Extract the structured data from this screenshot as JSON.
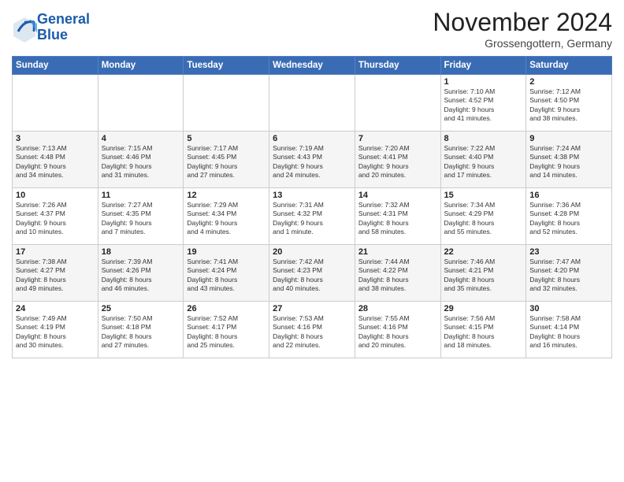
{
  "logo": {
    "line1": "General",
    "line2": "Blue"
  },
  "title": "November 2024",
  "location": "Grossengottern, Germany",
  "days_of_week": [
    "Sunday",
    "Monday",
    "Tuesday",
    "Wednesday",
    "Thursday",
    "Friday",
    "Saturday"
  ],
  "weeks": [
    [
      {
        "day": "",
        "info": ""
      },
      {
        "day": "",
        "info": ""
      },
      {
        "day": "",
        "info": ""
      },
      {
        "day": "",
        "info": ""
      },
      {
        "day": "",
        "info": ""
      },
      {
        "day": "1",
        "info": "Sunrise: 7:10 AM\nSunset: 4:52 PM\nDaylight: 9 hours\nand 41 minutes."
      },
      {
        "day": "2",
        "info": "Sunrise: 7:12 AM\nSunset: 4:50 PM\nDaylight: 9 hours\nand 38 minutes."
      }
    ],
    [
      {
        "day": "3",
        "info": "Sunrise: 7:13 AM\nSunset: 4:48 PM\nDaylight: 9 hours\nand 34 minutes."
      },
      {
        "day": "4",
        "info": "Sunrise: 7:15 AM\nSunset: 4:46 PM\nDaylight: 9 hours\nand 31 minutes."
      },
      {
        "day": "5",
        "info": "Sunrise: 7:17 AM\nSunset: 4:45 PM\nDaylight: 9 hours\nand 27 minutes."
      },
      {
        "day": "6",
        "info": "Sunrise: 7:19 AM\nSunset: 4:43 PM\nDaylight: 9 hours\nand 24 minutes."
      },
      {
        "day": "7",
        "info": "Sunrise: 7:20 AM\nSunset: 4:41 PM\nDaylight: 9 hours\nand 20 minutes."
      },
      {
        "day": "8",
        "info": "Sunrise: 7:22 AM\nSunset: 4:40 PM\nDaylight: 9 hours\nand 17 minutes."
      },
      {
        "day": "9",
        "info": "Sunrise: 7:24 AM\nSunset: 4:38 PM\nDaylight: 9 hours\nand 14 minutes."
      }
    ],
    [
      {
        "day": "10",
        "info": "Sunrise: 7:26 AM\nSunset: 4:37 PM\nDaylight: 9 hours\nand 10 minutes."
      },
      {
        "day": "11",
        "info": "Sunrise: 7:27 AM\nSunset: 4:35 PM\nDaylight: 9 hours\nand 7 minutes."
      },
      {
        "day": "12",
        "info": "Sunrise: 7:29 AM\nSunset: 4:34 PM\nDaylight: 9 hours\nand 4 minutes."
      },
      {
        "day": "13",
        "info": "Sunrise: 7:31 AM\nSunset: 4:32 PM\nDaylight: 9 hours\nand 1 minute."
      },
      {
        "day": "14",
        "info": "Sunrise: 7:32 AM\nSunset: 4:31 PM\nDaylight: 8 hours\nand 58 minutes."
      },
      {
        "day": "15",
        "info": "Sunrise: 7:34 AM\nSunset: 4:29 PM\nDaylight: 8 hours\nand 55 minutes."
      },
      {
        "day": "16",
        "info": "Sunrise: 7:36 AM\nSunset: 4:28 PM\nDaylight: 8 hours\nand 52 minutes."
      }
    ],
    [
      {
        "day": "17",
        "info": "Sunrise: 7:38 AM\nSunset: 4:27 PM\nDaylight: 8 hours\nand 49 minutes."
      },
      {
        "day": "18",
        "info": "Sunrise: 7:39 AM\nSunset: 4:26 PM\nDaylight: 8 hours\nand 46 minutes."
      },
      {
        "day": "19",
        "info": "Sunrise: 7:41 AM\nSunset: 4:24 PM\nDaylight: 8 hours\nand 43 minutes."
      },
      {
        "day": "20",
        "info": "Sunrise: 7:42 AM\nSunset: 4:23 PM\nDaylight: 8 hours\nand 40 minutes."
      },
      {
        "day": "21",
        "info": "Sunrise: 7:44 AM\nSunset: 4:22 PM\nDaylight: 8 hours\nand 38 minutes."
      },
      {
        "day": "22",
        "info": "Sunrise: 7:46 AM\nSunset: 4:21 PM\nDaylight: 8 hours\nand 35 minutes."
      },
      {
        "day": "23",
        "info": "Sunrise: 7:47 AM\nSunset: 4:20 PM\nDaylight: 8 hours\nand 32 minutes."
      }
    ],
    [
      {
        "day": "24",
        "info": "Sunrise: 7:49 AM\nSunset: 4:19 PM\nDaylight: 8 hours\nand 30 minutes."
      },
      {
        "day": "25",
        "info": "Sunrise: 7:50 AM\nSunset: 4:18 PM\nDaylight: 8 hours\nand 27 minutes."
      },
      {
        "day": "26",
        "info": "Sunrise: 7:52 AM\nSunset: 4:17 PM\nDaylight: 8 hours\nand 25 minutes."
      },
      {
        "day": "27",
        "info": "Sunrise: 7:53 AM\nSunset: 4:16 PM\nDaylight: 8 hours\nand 22 minutes."
      },
      {
        "day": "28",
        "info": "Sunrise: 7:55 AM\nSunset: 4:16 PM\nDaylight: 8 hours\nand 20 minutes."
      },
      {
        "day": "29",
        "info": "Sunrise: 7:56 AM\nSunset: 4:15 PM\nDaylight: 8 hours\nand 18 minutes."
      },
      {
        "day": "30",
        "info": "Sunrise: 7:58 AM\nSunset: 4:14 PM\nDaylight: 8 hours\nand 16 minutes."
      }
    ]
  ]
}
